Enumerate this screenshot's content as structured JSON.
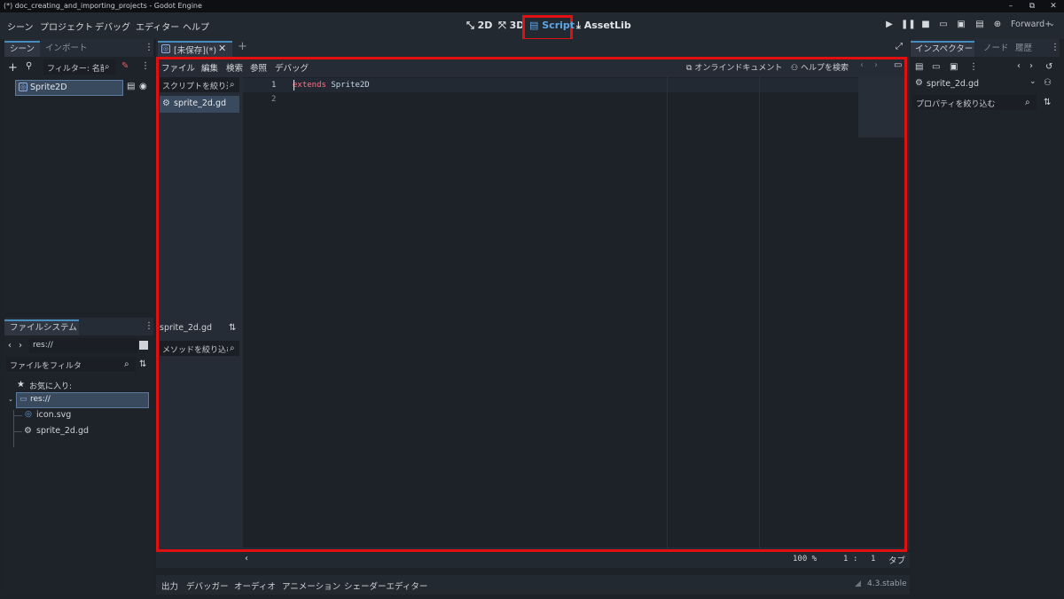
{
  "window": {
    "title": "(*) doc_creating_and_importing_projects - Godot Engine",
    "minimize": "–",
    "maximize": "⧉",
    "close": "✕"
  },
  "menu": [
    "シーン",
    "プロジェクト",
    "デバッグ",
    "エディター",
    "ヘルプ"
  ],
  "workspaces": {
    "w2d": "2D",
    "w3d": "3D",
    "script": "Script",
    "assetlib": "AssetLib"
  },
  "renderer": "Forward+",
  "scene_dock": {
    "tabs": [
      "シーン",
      "インポート"
    ],
    "filter_placeholder": "フィルター: 名前",
    "node": "Sprite2D"
  },
  "filesystem_dock": {
    "tab": "ファイルシステム",
    "path": "res://",
    "filter_placeholder": "ファイルをフィルタ",
    "favorites": "お気に入り:",
    "root": "res://",
    "files": [
      "icon.svg",
      "sprite_2d.gd"
    ]
  },
  "editor_tab": {
    "label": "[未保存](*)"
  },
  "script_menu": [
    "ファイル",
    "編集",
    "検索",
    "参照",
    "デバッグ"
  ],
  "script_toolbar": {
    "online_docs": "オンラインドキュメント",
    "search_help": "ヘルプを検索"
  },
  "script_list": {
    "filter_placeholder": "スクリプトを絞り込む",
    "items": [
      "sprite_2d.gd"
    ]
  },
  "method_panel": {
    "file": "sprite_2d.gd",
    "filter_placeholder": "メソッドを絞り込む"
  },
  "code": {
    "lines": [
      {
        "num": "1",
        "keyword": "extends",
        "text": " Sprite2D"
      },
      {
        "num": "2",
        "keyword": "",
        "text": ""
      }
    ]
  },
  "status": {
    "zoom": "100 %",
    "line": "1",
    "sep": ":",
    "col": "1",
    "indent": "タブ"
  },
  "bottom_panels": [
    "出力",
    "デバッガー",
    "オーディオ",
    "アニメーション",
    "シェーダーエディター"
  ],
  "version": "4.3.stable",
  "inspector": {
    "tabs": [
      "インスペクター",
      "ノード",
      "履歴"
    ],
    "resource": "sprite_2d.gd",
    "filter_placeholder": "プロパティを絞り込む"
  },
  "colors": {
    "accent": "#478cbf",
    "keyword": "#ff7085",
    "highlight": "#e01010"
  }
}
